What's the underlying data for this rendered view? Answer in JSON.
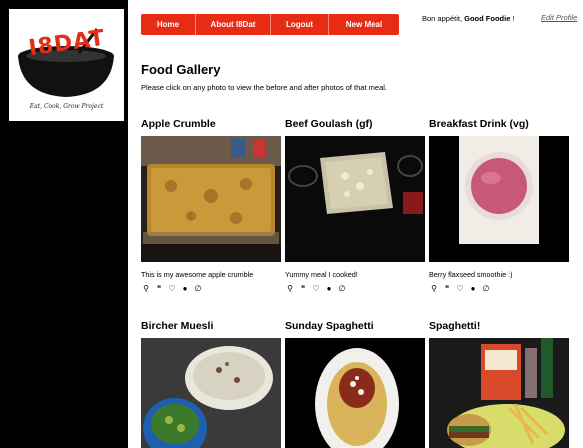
{
  "logo": {
    "brand": "I8DAT",
    "tagline": "Eat, Cook, Grow Project",
    "brand_color": "#e62c15"
  },
  "nav": {
    "items": [
      "Home",
      "About I8Dat",
      "Logout",
      "New Meal"
    ],
    "color": "#e62c15"
  },
  "user": {
    "greeting_prefix": "Bon appétit,",
    "name": "Good Foodie",
    "greeting_suffix": "!",
    "edit_label": "Edit Profile"
  },
  "gallery": {
    "title": "Food Gallery",
    "instructions": "Please click on any photo to view the before and after photos of that meal.",
    "action_icons": [
      "magnifier-icon",
      "quote-icon",
      "heart-icon",
      "person-icon",
      "empty-set-icon"
    ],
    "meals": [
      {
        "title": "Apple Crumble",
        "caption": "This is my awesome apple crumble"
      },
      {
        "title": "Beef Goulash (gf)",
        "caption": "Yummy meal I cooked!"
      },
      {
        "title": "Breakfast Drink (vg)",
        "caption": "Berry flaxseed smoothie :)"
      },
      {
        "title": "Bircher Muesli",
        "caption": ""
      },
      {
        "title": "Sunday Spaghetti",
        "caption": ""
      },
      {
        "title": "Spaghetti!",
        "caption": ""
      }
    ]
  }
}
